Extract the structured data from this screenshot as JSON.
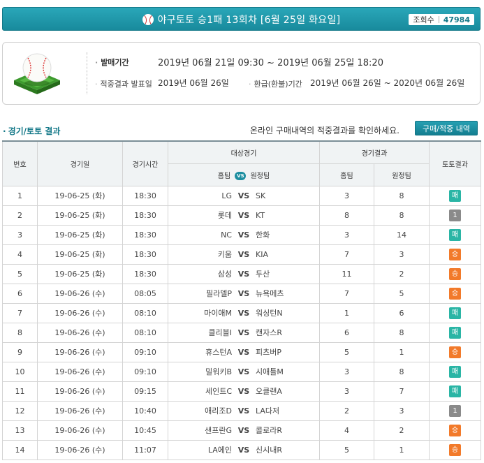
{
  "header": {
    "title": "야구토토 승1패 13회차 [6월 25일 화요일]",
    "views_label": "조회수",
    "views_count": "47984"
  },
  "info": {
    "sale_period_label": "발매기간",
    "sale_period_value": "2019년 06월 21일 09:30 ~ 2019년 06월 25일 18:20",
    "announce_label": "적중결과 발표일",
    "announce_value": "2019년 06월 26일",
    "refund_label": "환급(환불)기간",
    "refund_value": "2019년 06월 26일 ~ 2020년 06월 26일"
  },
  "section": {
    "title": "경기/토토 결과",
    "note": "온라인 구매내역의 적중결과를 확인하세요.",
    "button_label": "구매/적중 내역"
  },
  "table": {
    "headers": {
      "no": "번호",
      "date": "경기일",
      "time": "경기시간",
      "match": "대상경기",
      "home": "홈팀",
      "vs": "VS",
      "away": "원정팀",
      "result": "경기결과",
      "result_home": "홈팀",
      "result_away": "원정팀",
      "toto": "토토결과"
    },
    "vs_text": "VS",
    "result_styles": {
      "패": "lose",
      "1": "draw",
      "승": "win"
    },
    "rows": [
      {
        "no": "1",
        "date": "19-06-25 (화)",
        "time": "18:30",
        "home": "LG",
        "away": "SK",
        "hs": "3",
        "as": "8",
        "toto": "패"
      },
      {
        "no": "2",
        "date": "19-06-25 (화)",
        "time": "18:30",
        "home": "롯데",
        "away": "KT",
        "hs": "8",
        "as": "8",
        "toto": "1"
      },
      {
        "no": "3",
        "date": "19-06-25 (화)",
        "time": "18:30",
        "home": "NC",
        "away": "한화",
        "hs": "3",
        "as": "14",
        "toto": "패"
      },
      {
        "no": "4",
        "date": "19-06-25 (화)",
        "time": "18:30",
        "home": "키움",
        "away": "KIA",
        "hs": "7",
        "as": "3",
        "toto": "승"
      },
      {
        "no": "5",
        "date": "19-06-25 (화)",
        "time": "18:30",
        "home": "삼성",
        "away": "두산",
        "hs": "11",
        "as": "2",
        "toto": "승"
      },
      {
        "no": "6",
        "date": "19-06-26 (수)",
        "time": "08:05",
        "home": "필라델P",
        "away": "뉴욕메츠",
        "hs": "7",
        "as": "5",
        "toto": "승"
      },
      {
        "no": "7",
        "date": "19-06-26 (수)",
        "time": "08:10",
        "home": "마이애M",
        "away": "워싱턴N",
        "hs": "1",
        "as": "6",
        "toto": "패"
      },
      {
        "no": "8",
        "date": "19-06-26 (수)",
        "time": "08:10",
        "home": "클리블I",
        "away": "캔자스R",
        "hs": "6",
        "as": "8",
        "toto": "패"
      },
      {
        "no": "9",
        "date": "19-06-26 (수)",
        "time": "09:10",
        "home": "휴스턴A",
        "away": "피츠버P",
        "hs": "5",
        "as": "1",
        "toto": "승"
      },
      {
        "no": "10",
        "date": "19-06-26 (수)",
        "time": "09:10",
        "home": "밀워키B",
        "away": "시애틀M",
        "hs": "3",
        "as": "8",
        "toto": "패"
      },
      {
        "no": "11",
        "date": "19-06-26 (수)",
        "time": "09:15",
        "home": "세인트C",
        "away": "오클랜A",
        "hs": "3",
        "as": "7",
        "toto": "패"
      },
      {
        "no": "12",
        "date": "19-06-26 (수)",
        "time": "10:40",
        "home": "애리조D",
        "away": "LA다저",
        "hs": "2",
        "as": "3",
        "toto": "1"
      },
      {
        "no": "13",
        "date": "19-06-26 (수)",
        "time": "10:45",
        "home": "샌프란G",
        "away": "콜로라R",
        "hs": "4",
        "as": "2",
        "toto": "승"
      },
      {
        "no": "14",
        "date": "19-06-26 (수)",
        "time": "11:07",
        "home": "LA에인",
        "away": "신시내R",
        "hs": "5",
        "as": "1",
        "toto": "승"
      }
    ]
  }
}
